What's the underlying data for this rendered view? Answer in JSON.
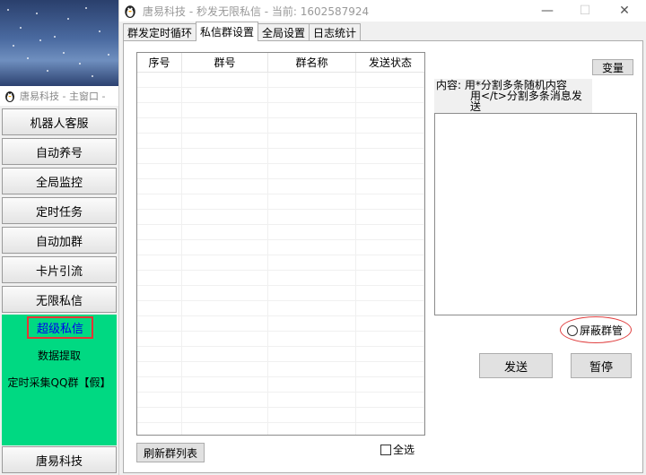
{
  "sidebar": {
    "window_title": "唐易科技 - 主窗口 -",
    "items": [
      {
        "label": "机器人客服"
      },
      {
        "label": "自动养号"
      },
      {
        "label": "全局监控"
      },
      {
        "label": "定时任务"
      },
      {
        "label": "自动加群"
      },
      {
        "label": "卡片引流"
      },
      {
        "label": "无限私信"
      }
    ],
    "active_item": "超级私信",
    "green_items": [
      "数据提取",
      "定时采集QQ群【假】"
    ],
    "brand_button": "唐易科技",
    "green_color": "#00d982",
    "highlight_color": "#e83434"
  },
  "window": {
    "title": "唐易科技 - 秒发无限私信 - 当前: 1602587924",
    "controls": {
      "minimize": "—",
      "maximize": "☐",
      "close": "✕"
    }
  },
  "tabs": [
    {
      "label": "群发定时循环",
      "active": false
    },
    {
      "label": "私信群设置",
      "active": true
    },
    {
      "label": "全局设置",
      "active": false
    },
    {
      "label": "日志统计",
      "active": false
    }
  ],
  "table": {
    "columns": [
      "序号",
      "群号",
      "群名称",
      "发送状态"
    ],
    "rows": []
  },
  "buttons": {
    "refresh": "刷新群列表",
    "select_all": "全选",
    "variable": "变量",
    "send": "发送",
    "pause": "暂停"
  },
  "content": {
    "label": "内容:",
    "hint_line1": "用*分割多条随机内容",
    "hint_line2": "用</t>分割多条消息发送",
    "value": ""
  },
  "mask_admin": {
    "label": "屏蔽群管",
    "checked": false
  }
}
